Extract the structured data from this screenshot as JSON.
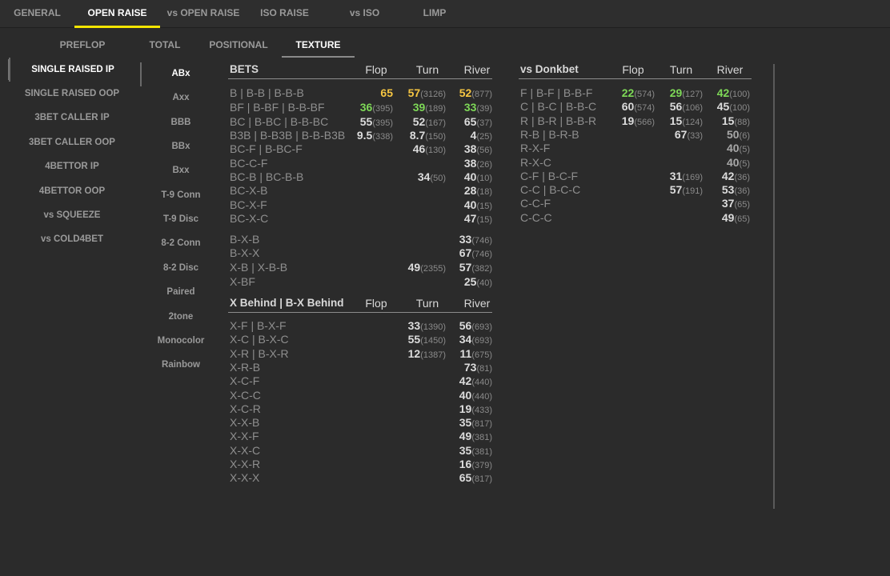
{
  "tabs": [
    "GENERAL",
    "OPEN RAISE",
    "vs OPEN RAISE",
    "ISO RAISE",
    "vs ISO",
    "LIMP"
  ],
  "subtabs": [
    "PREFLOP",
    "TOTAL",
    "POSITIONAL",
    "TEXTURE"
  ],
  "situations": [
    "SINGLE RAISED IP",
    "SINGLE RAISED OOP",
    "3BET CALLER IP",
    "3BET CALLER OOP",
    "4BETTOR IP",
    "4BETTOR OOP",
    "vs SQUEEZE",
    "vs COLD4BET"
  ],
  "textures": [
    "ABx",
    "Axx",
    "BBB",
    "BBx",
    "Bxx",
    "T-9 Conn",
    "T-9 Disc",
    "8-2 Conn",
    "8-2 Disc",
    "Paired",
    "2tone",
    "Monocolor",
    "Rainbow"
  ],
  "colors": {
    "accent": "#f3e600",
    "yellow": "#f5c542",
    "green": "#7ed957"
  },
  "bets": {
    "title": "BETS",
    "cols": [
      "Flop",
      "Turn",
      "River"
    ],
    "rows": [
      {
        "label": "B | B-B | B-B-B",
        "c": [
          [
            "65",
            "",
            "y"
          ],
          [
            "57",
            "(3126)",
            "y"
          ],
          [
            "52",
            "(877)",
            "y"
          ]
        ]
      },
      {
        "label": "BF | B-BF | B-B-BF",
        "c": [
          [
            "36",
            "(395)",
            "g"
          ],
          [
            "39",
            "(189)",
            "g"
          ],
          [
            "33",
            "(39)",
            "g"
          ]
        ]
      },
      {
        "label": "BC | B-BC | B-B-BC",
        "c": [
          [
            "55",
            "(395)",
            ""
          ],
          [
            "52",
            "(167)",
            ""
          ],
          [
            "65",
            "(37)",
            ""
          ]
        ]
      },
      {
        "label": "B3B | B-B3B | B-B-B3B",
        "c": [
          [
            "9.5",
            "(338)",
            ""
          ],
          [
            "8.7",
            "(150)",
            ""
          ],
          [
            "4",
            "(25)",
            ""
          ]
        ]
      },
      {
        "label": "BC-F | B-BC-F",
        "c": [
          [
            "",
            "",
            ""
          ],
          [
            "46",
            "(130)",
            ""
          ],
          [
            "38",
            "(56)",
            ""
          ]
        ]
      },
      {
        "label": "BC-C-F",
        "c": [
          [
            "",
            "",
            ""
          ],
          [
            "",
            "",
            ""
          ],
          [
            "38",
            "(26)",
            ""
          ]
        ]
      },
      {
        "label": "BC-B | BC-B-B",
        "c": [
          [
            "",
            "",
            ""
          ],
          [
            "34",
            "(50)",
            ""
          ],
          [
            "40",
            "(10)",
            ""
          ]
        ]
      },
      {
        "label": "BC-X-B",
        "c": [
          [
            "",
            "",
            ""
          ],
          [
            "",
            "",
            ""
          ],
          [
            "28",
            "(18)",
            ""
          ]
        ]
      },
      {
        "label": "BC-X-F",
        "c": [
          [
            "",
            "",
            ""
          ],
          [
            "",
            "",
            ""
          ],
          [
            "40",
            "(15)",
            ""
          ]
        ]
      },
      {
        "label": "BC-X-C",
        "c": [
          [
            "",
            "",
            ""
          ],
          [
            "",
            "",
            ""
          ],
          [
            "47",
            "(15)",
            ""
          ]
        ]
      },
      {
        "label": "B-X-B",
        "c": [
          [
            "",
            "",
            ""
          ],
          [
            "",
            "",
            ""
          ],
          [
            "33",
            "(746)",
            ""
          ]
        ]
      },
      {
        "label": "B-X-X",
        "c": [
          [
            "",
            "",
            ""
          ],
          [
            "",
            "",
            ""
          ],
          [
            "67",
            "(746)",
            ""
          ]
        ]
      },
      {
        "label": "X-B | X-B-B",
        "c": [
          [
            "",
            "",
            ""
          ],
          [
            "49",
            "(2355)",
            ""
          ],
          [
            "57",
            "(382)",
            ""
          ]
        ]
      },
      {
        "label": "X-BF",
        "c": [
          [
            "",
            "",
            ""
          ],
          [
            "",
            "",
            ""
          ],
          [
            "25",
            "(40)",
            ""
          ]
        ]
      }
    ]
  },
  "behind": {
    "title": "X Behind | B-X Behind",
    "cols": [
      "Flop",
      "Turn",
      "River"
    ],
    "rows": [
      {
        "label": "X-F | B-X-F",
        "c": [
          [
            "",
            "",
            ""
          ],
          [
            "33",
            "(1390)",
            ""
          ],
          [
            "56",
            "(693)",
            ""
          ]
        ]
      },
      {
        "label": "X-C | B-X-C",
        "c": [
          [
            "",
            "",
            ""
          ],
          [
            "55",
            "(1450)",
            ""
          ],
          [
            "34",
            "(693)",
            ""
          ]
        ]
      },
      {
        "label": "X-R | B-X-R",
        "c": [
          [
            "",
            "",
            ""
          ],
          [
            "12",
            "(1387)",
            ""
          ],
          [
            "11",
            "(675)",
            ""
          ]
        ]
      },
      {
        "label": "X-R-B",
        "c": [
          [
            "",
            "",
            ""
          ],
          [
            "",
            "",
            ""
          ],
          [
            "73",
            "(81)",
            ""
          ]
        ]
      },
      {
        "label": "X-C-F",
        "c": [
          [
            "",
            "",
            ""
          ],
          [
            "",
            "",
            ""
          ],
          [
            "42",
            "(440)",
            ""
          ]
        ]
      },
      {
        "label": "X-C-C",
        "c": [
          [
            "",
            "",
            ""
          ],
          [
            "",
            "",
            ""
          ],
          [
            "40",
            "(440)",
            ""
          ]
        ]
      },
      {
        "label": "X-C-R",
        "c": [
          [
            "",
            "",
            ""
          ],
          [
            "",
            "",
            ""
          ],
          [
            "19",
            "(433)",
            ""
          ]
        ]
      },
      {
        "label": "X-X-B",
        "c": [
          [
            "",
            "",
            ""
          ],
          [
            "",
            "",
            ""
          ],
          [
            "35",
            "(817)",
            ""
          ]
        ]
      },
      {
        "label": "X-X-F",
        "c": [
          [
            "",
            "",
            ""
          ],
          [
            "",
            "",
            ""
          ],
          [
            "49",
            "(381)",
            ""
          ]
        ]
      },
      {
        "label": "X-X-C",
        "c": [
          [
            "",
            "",
            ""
          ],
          [
            "",
            "",
            ""
          ],
          [
            "35",
            "(381)",
            ""
          ]
        ]
      },
      {
        "label": "X-X-R",
        "c": [
          [
            "",
            "",
            ""
          ],
          [
            "",
            "",
            ""
          ],
          [
            "16",
            "(379)",
            ""
          ]
        ]
      },
      {
        "label": "X-X-X",
        "c": [
          [
            "",
            "",
            ""
          ],
          [
            "",
            "",
            ""
          ],
          [
            "65",
            "(817)",
            ""
          ]
        ]
      }
    ]
  },
  "donk": {
    "title": "vs Donkbet",
    "cols": [
      "Flop",
      "Turn",
      "River"
    ],
    "rows": [
      {
        "label": "F | B-F | B-B-F",
        "c": [
          [
            "22",
            "(574)",
            "g"
          ],
          [
            "29",
            "(127)",
            "g"
          ],
          [
            "42",
            "(100)",
            "g"
          ]
        ]
      },
      {
        "label": "C | B-C | B-B-C",
        "c": [
          [
            "60",
            "(574)",
            ""
          ],
          [
            "56",
            "(106)",
            ""
          ],
          [
            "45",
            "(100)",
            ""
          ]
        ]
      },
      {
        "label": "R | B-R | B-B-R",
        "c": [
          [
            "19",
            "(566)",
            ""
          ],
          [
            "15",
            "(124)",
            ""
          ],
          [
            "15",
            "(88)",
            ""
          ]
        ]
      },
      {
        "label": "R-B | B-R-B",
        "c": [
          [
            "",
            "",
            ""
          ],
          [
            "67",
            "(33)",
            ""
          ],
          [
            "50",
            "(6)",
            "d"
          ]
        ]
      },
      {
        "label": "R-X-F",
        "c": [
          [
            "",
            "",
            ""
          ],
          [
            "",
            "",
            ""
          ],
          [
            "40",
            "(5)",
            "d"
          ]
        ]
      },
      {
        "label": "R-X-C",
        "c": [
          [
            "",
            "",
            ""
          ],
          [
            "",
            "",
            ""
          ],
          [
            "40",
            "(5)",
            "d"
          ]
        ]
      },
      {
        "label": "C-F | B-C-F",
        "c": [
          [
            "",
            "",
            ""
          ],
          [
            "31",
            "(169)",
            ""
          ],
          [
            "42",
            "(36)",
            ""
          ]
        ]
      },
      {
        "label": "C-C | B-C-C",
        "c": [
          [
            "",
            "",
            ""
          ],
          [
            "57",
            "(191)",
            ""
          ],
          [
            "53",
            "(36)",
            ""
          ]
        ]
      },
      {
        "label": "C-C-F",
        "c": [
          [
            "",
            "",
            ""
          ],
          [
            "",
            "",
            ""
          ],
          [
            "37",
            "(65)",
            ""
          ]
        ]
      },
      {
        "label": "C-C-C",
        "c": [
          [
            "",
            "",
            ""
          ],
          [
            "",
            "",
            ""
          ],
          [
            "49",
            "(65)",
            ""
          ]
        ]
      }
    ]
  }
}
